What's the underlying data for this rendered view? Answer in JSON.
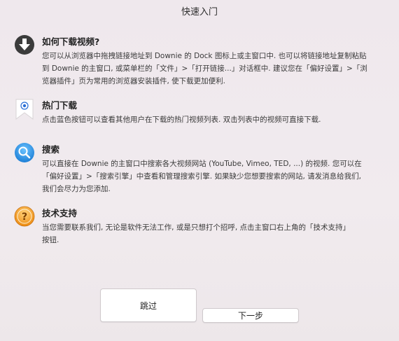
{
  "window": {
    "title": "快速入门"
  },
  "sections": [
    {
      "icon": "download-arrow-icon",
      "title": "如何下载视频?",
      "lines": [
        "您可以从浏览器中拖拽链接地址到 Downie 的 Dock 图标上或主窗口中. 也可以将链接地址复制粘贴",
        "到 Downie 的主窗口, 或菜单栏的「文件」>「打开链接...」对话框中. 建议您在「偏好设置」>「浏",
        "览器插件」页为常用的浏览器安装插件, 使下载更加便利."
      ]
    },
    {
      "icon": "bookmark-icon",
      "title": "热门下载",
      "lines": [
        "点击蓝色按钮可以查看其他用户在下载的热门视频列表. 双击列表中的视频可直接下载."
      ]
    },
    {
      "icon": "magnifier-icon",
      "title": "搜索",
      "lines": [
        "可以直接在 Downie 的主窗口中搜索各大视频网站 (YouTube, Vimeo, TED, ...) 的视频. 您可以在",
        "「偏好设置」>「搜索引擎」中查看和管理搜索引擎. 如果缺少您想要搜索的网站, 请发消息给我们,",
        "我们会尽力为您添加."
      ]
    },
    {
      "icon": "question-icon",
      "title": "技术支持",
      "lines": [
        "当您需要联系我们, 无论是软件无法工作, 或是只想打个招呼, 点击主窗口右上角的「技术支持」",
        "按钮."
      ]
    }
  ],
  "buttons": {
    "skip": "跳过",
    "next": "下一步"
  },
  "colors": {
    "search_blue": "#1d8ce0",
    "support_orange": "#f09a1c",
    "bookmark_blue": "#2a6fd6"
  }
}
